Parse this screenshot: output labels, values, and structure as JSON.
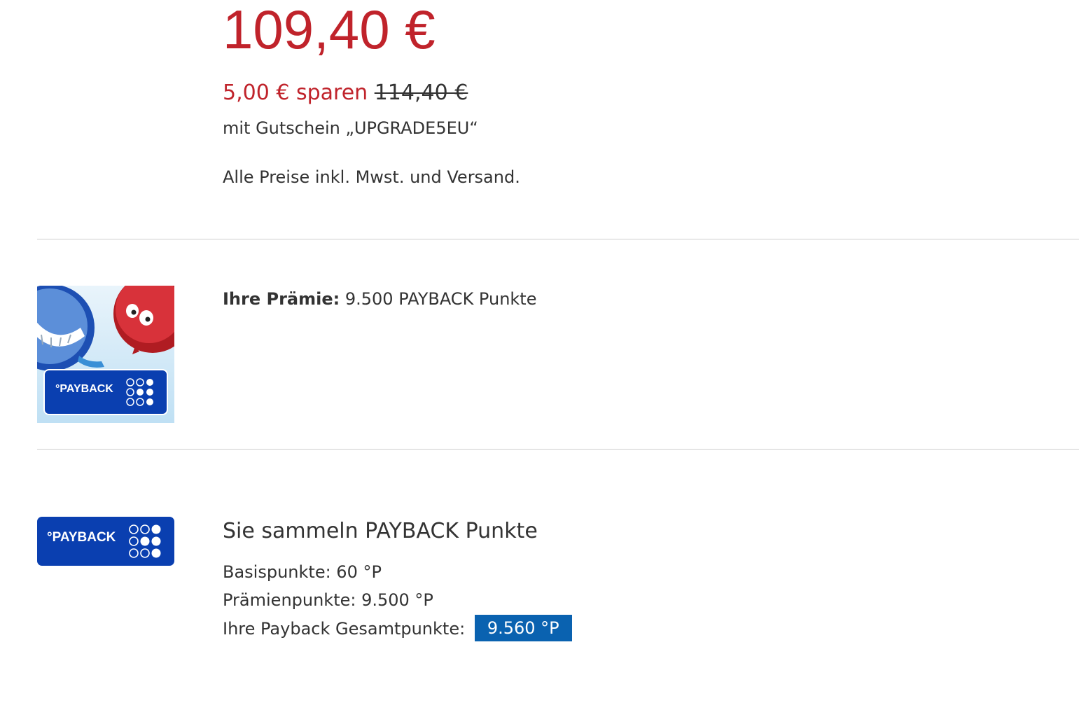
{
  "price": {
    "current": "109,40 €",
    "savings": "5,00 € sparen",
    "original": "114,40 €",
    "voucher": "mit Gutschein „UPGRADE5EU“",
    "note": "Alle Preise inkl. Mwst. und Versand."
  },
  "reward": {
    "label": "Ihre Prämie:",
    "value": "9.500 PAYBACK Punkte",
    "logo_text": "°PAYBACK"
  },
  "payback": {
    "logo_text": "°PAYBACK",
    "title": "Sie sammeln PAYBACK Punkte",
    "base_label": "Basispunkte: 60 °P",
    "bonus_label": "Prämienpunkte: 9.500 °P",
    "total_label": "Ihre Payback Gesamtpunkte:",
    "total_value": "9.560 °P"
  },
  "colors": {
    "price_red": "#c0232b",
    "payback_blue": "#0a3fb0",
    "badge_blue": "#0a62b0"
  }
}
